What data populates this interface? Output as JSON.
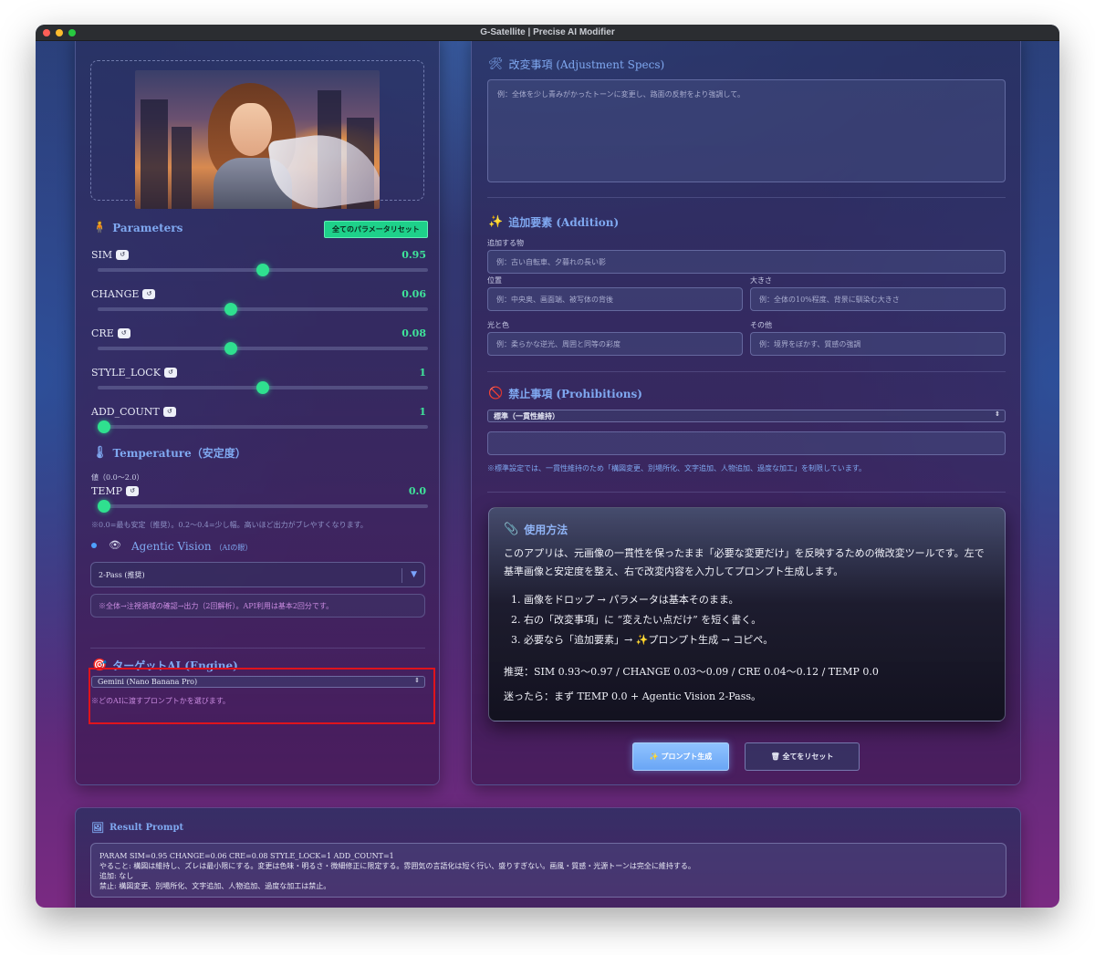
{
  "window": {
    "title": "G-Satellite | Precise AI Modifier"
  },
  "left": {
    "params_title": "Parameters",
    "reset_all_params": "全てのパラメータリセット",
    "reset_chip": "↺",
    "params": [
      {
        "name": "SIM",
        "value": "0.95",
        "fraction": 0.5
      },
      {
        "name": "CHANGE",
        "value": "0.06",
        "fraction": 0.4
      },
      {
        "name": "CRE",
        "value": "0.08",
        "fraction": 0.4
      },
      {
        "name": "STYLE_LOCK",
        "value": "1",
        "fraction": 0.5
      },
      {
        "name": "ADD_COUNT",
        "value": "1",
        "fraction": 0.0
      }
    ],
    "temperature_title": "Temperature（安定度）",
    "temperature_range": "値（0.0〜2.0）",
    "temp_label": "TEMP",
    "temp_value": "0.0",
    "temp_fraction": 0.0,
    "temp_hint": "※0.0=最も安定（推奨）。0.2〜0.4=少し幅。高いほど出力がブレやすくなります。",
    "agentic_title": "Agentic Vision",
    "agentic_sub": "（AIの眼）",
    "agentic_selected": "2-Pass (推奨)",
    "agentic_desc": "※全体→注視領域の確認→出力（2回解析）。API利用は基本2回分です。",
    "target_title": "ターゲットAI (Engine)",
    "target_selected": "Gemini (Nano Banana Pro)",
    "target_hint": "※どのAIに渡すプロンプトかを選びます。"
  },
  "right": {
    "adjust_title": "改変事項 (Adjustment Specs)",
    "adjust_placeholder": "例：全体を少し青みがかったトーンに変更し、路面の反射をより強調して。",
    "addition_title": "追加要素 (Addition)",
    "add_item_label": "追加する物",
    "add_item_placeholder": "例：古い自転車、夕暮れの長い影",
    "position_label": "位置",
    "position_placeholder": "例：中央奥、画面端、被写体の背後",
    "size_label": "大きさ",
    "size_placeholder": "例：全体の10%程度、背景に馴染む大きさ",
    "light_label": "光と色",
    "light_placeholder": "例：柔らかな逆光、周囲と同等の彩度",
    "other_label": "その他",
    "other_placeholder": "例：境界をぼかす、質感の強調",
    "prohibit_title": "禁止事項 (Prohibitions)",
    "prohibit_selected": "標準（一貫性維持）",
    "prohibit_note": "※標準設定では、一貫性維持のため「構図変更、別場所化、文字追加、人物追加、過度な加工」を制限しています。",
    "usage_title": "使用方法",
    "usage_intro": "このアプリは、元画像の一貫性を保ったまま「必要な変更だけ」を反映するための微改変ツールです。左で基準画像と安定度を整え、右で改変内容を入力してプロンプト生成します。",
    "usage_steps": [
      "画像をドロップ → パラメータは基本そのまま。",
      "右の「改変事項」に “変えたい点だけ” を短く書く。",
      "必要なら「追加要素」→ ✨プロンプト生成 → コピペ。"
    ],
    "usage_recommend": "推奨：SIM 0.93〜0.97 / CHANGE 0.03〜0.09 / CRE 0.04〜0.12 / TEMP 0.0",
    "usage_tip": "迷ったら：まず TEMP 0.0 + Agentic Vision 2-Pass。",
    "generate_button": "✨ プロンプト生成",
    "reset_all_button": "🗑 全てをリセット"
  },
  "result": {
    "title": "Result Prompt",
    "lines": [
      "PARAM SIM=0.95 CHANGE=0.06 CRE=0.08 STYLE_LOCK=1 ADD_COUNT=1",
      "やること: 構図は維持し、ズレは最小限にする。変更は色味・明るさ・微細修正に限定する。雰囲気の言語化は短く行い、盛りすぎない。画風・質感・光源トーンは完全に維持する。",
      "追加: なし",
      "禁止: 構図変更、別場所化、文字追加、人物追加、過度な加工は禁止。"
    ]
  },
  "icons": {
    "params": "🧍",
    "temperature": "🌡",
    "agentic": "👁",
    "target": "🎯",
    "adjust": "🛠",
    "addition": "✨",
    "prohibit": "🚫",
    "usage": "📎",
    "result": "🖼"
  },
  "colors": {
    "accent_green": "#2fe08f",
    "title_blue": "#7fa8f0",
    "highlight_red": "#e0141c"
  }
}
